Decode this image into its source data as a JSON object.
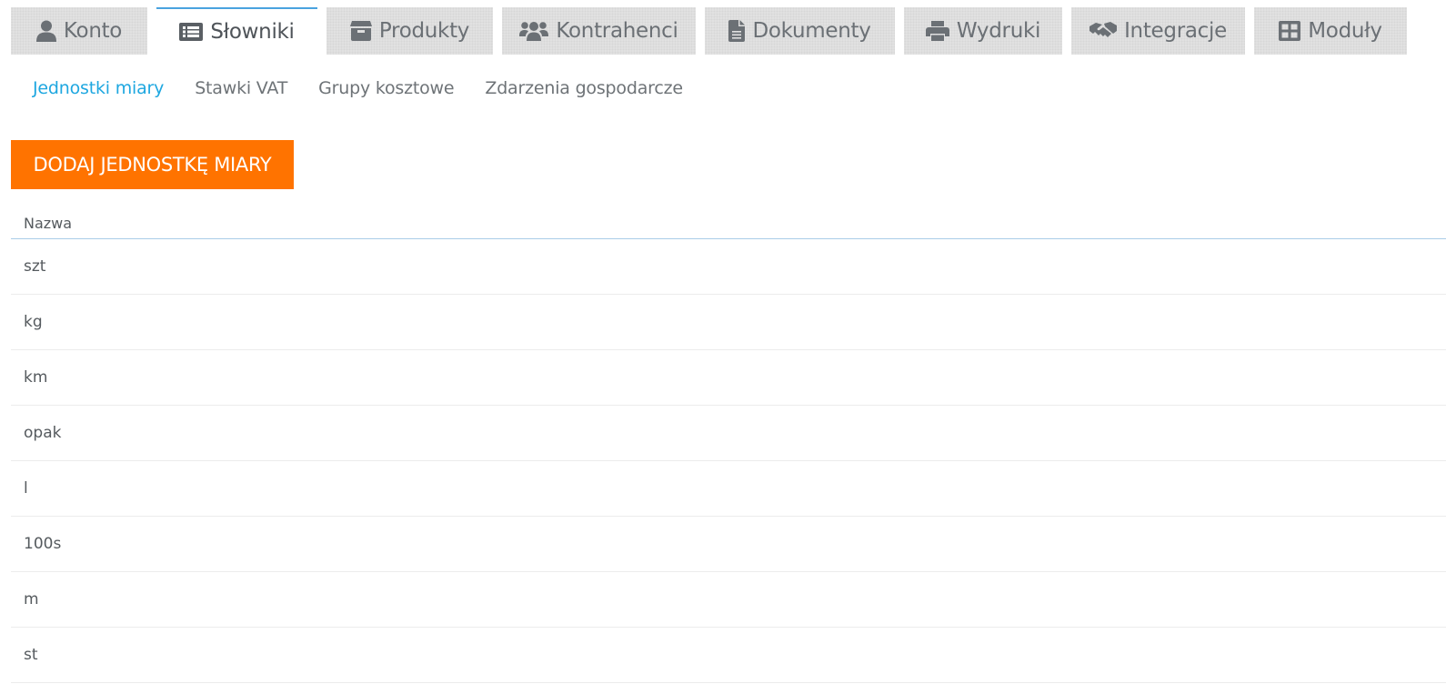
{
  "tabs": [
    {
      "label": "Konto",
      "icon": "user-icon"
    },
    {
      "label": "Słowniki",
      "icon": "list-icon"
    },
    {
      "label": "Produkty",
      "icon": "box-icon"
    },
    {
      "label": "Kontrahenci",
      "icon": "users-icon"
    },
    {
      "label": "Dokumenty",
      "icon": "document-icon"
    },
    {
      "label": "Wydruki",
      "icon": "printer-icon"
    },
    {
      "label": "Integracje",
      "icon": "handshake-icon"
    },
    {
      "label": "Moduły",
      "icon": "grid-icon"
    }
  ],
  "active_tab": "Słowniki",
  "subtabs": [
    "Jednostki miary",
    "Stawki VAT",
    "Grupy kosztowe",
    "Zdarzenia gospodarcze"
  ],
  "active_subtab": "Jednostki miary",
  "add_button_label": "DODAJ JEDNOSTKĘ MIARY",
  "table": {
    "header": "Nazwa",
    "rows": [
      "szt",
      "kg",
      "km",
      "opak",
      "l",
      "100s",
      "m",
      "st"
    ]
  },
  "colors": {
    "accent_blue": "#1ea7e0",
    "button_orange": "#ff7300",
    "tab_bg": "#e1e1e1"
  }
}
